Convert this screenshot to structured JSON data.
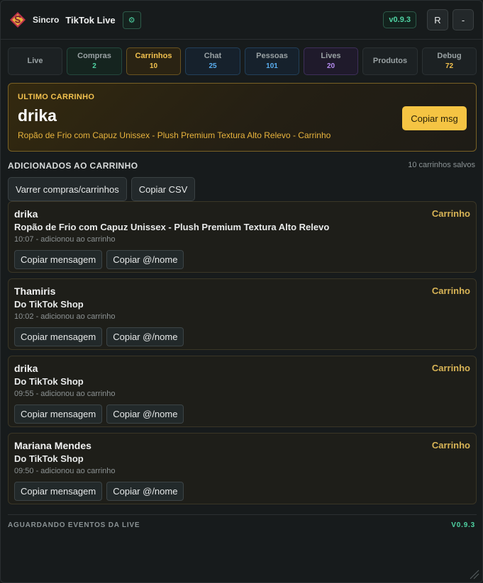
{
  "header": {
    "brand": "Sincro",
    "title": "TikTok Live",
    "settings_icon": "gear-icon",
    "version": "v0.9.3",
    "r_label": "R",
    "minimize_label": "-"
  },
  "tabs": [
    {
      "label": "Live",
      "count": ""
    },
    {
      "label": "Compras",
      "count": "2"
    },
    {
      "label": "Carrinhos",
      "count": "10"
    },
    {
      "label": "Chat",
      "count": "25"
    },
    {
      "label": "Pessoas",
      "count": "101"
    },
    {
      "label": "Lives",
      "count": "20"
    },
    {
      "label": "Produtos",
      "count": ""
    },
    {
      "label": "Debug",
      "count": "72"
    }
  ],
  "last_cart": {
    "eyebrow": "ULTIMO CARRINHO",
    "name": "drika",
    "product": "Ropão de Frio com Capuz Unissex - Plush Premium Textura Alto Relevo - Carrinho",
    "copy_label": "Copiar msg"
  },
  "section": {
    "title": "ADICIONADOS AO CARRINHO",
    "saved": "10 carrinhos salvos",
    "scan_label": "Varrer compras/carrinhos",
    "csv_label": "Copiar CSV"
  },
  "items": [
    {
      "name": "drika",
      "tag": "Carrinho",
      "product": "Ropão de Frio com Capuz Unissex - Plush Premium Textura Alto Relevo",
      "meta": "10:07 - adicionou ao carrinho",
      "copy_msg": "Copiar mensagem",
      "copy_name": "Copiar @/nome"
    },
    {
      "name": "Thamiris",
      "tag": "Carrinho",
      "product": "Do TikTok Shop",
      "meta": "10:02 - adicionou ao carrinho",
      "copy_msg": "Copiar mensagem",
      "copy_name": "Copiar @/nome"
    },
    {
      "name": "drika",
      "tag": "Carrinho",
      "product": "Do TikTok Shop",
      "meta": "09:55 - adicionou ao carrinho",
      "copy_msg": "Copiar mensagem",
      "copy_name": "Copiar @/nome"
    },
    {
      "name": "Mariana Mendes",
      "tag": "Carrinho",
      "product": "Do TikTok Shop",
      "meta": "09:50 - adicionou ao carrinho",
      "copy_msg": "Copiar mensagem",
      "copy_name": "Copiar @/nome"
    }
  ],
  "footer": {
    "status": "AGUARDANDO EVENTOS DA LIVE",
    "version": "V0.9.3"
  },
  "colors": {
    "accent_green": "#4fd3a3",
    "accent_yellow": "#f2c14e",
    "accent_blue": "#5aaef0",
    "accent_purple": "#b58cf0"
  }
}
